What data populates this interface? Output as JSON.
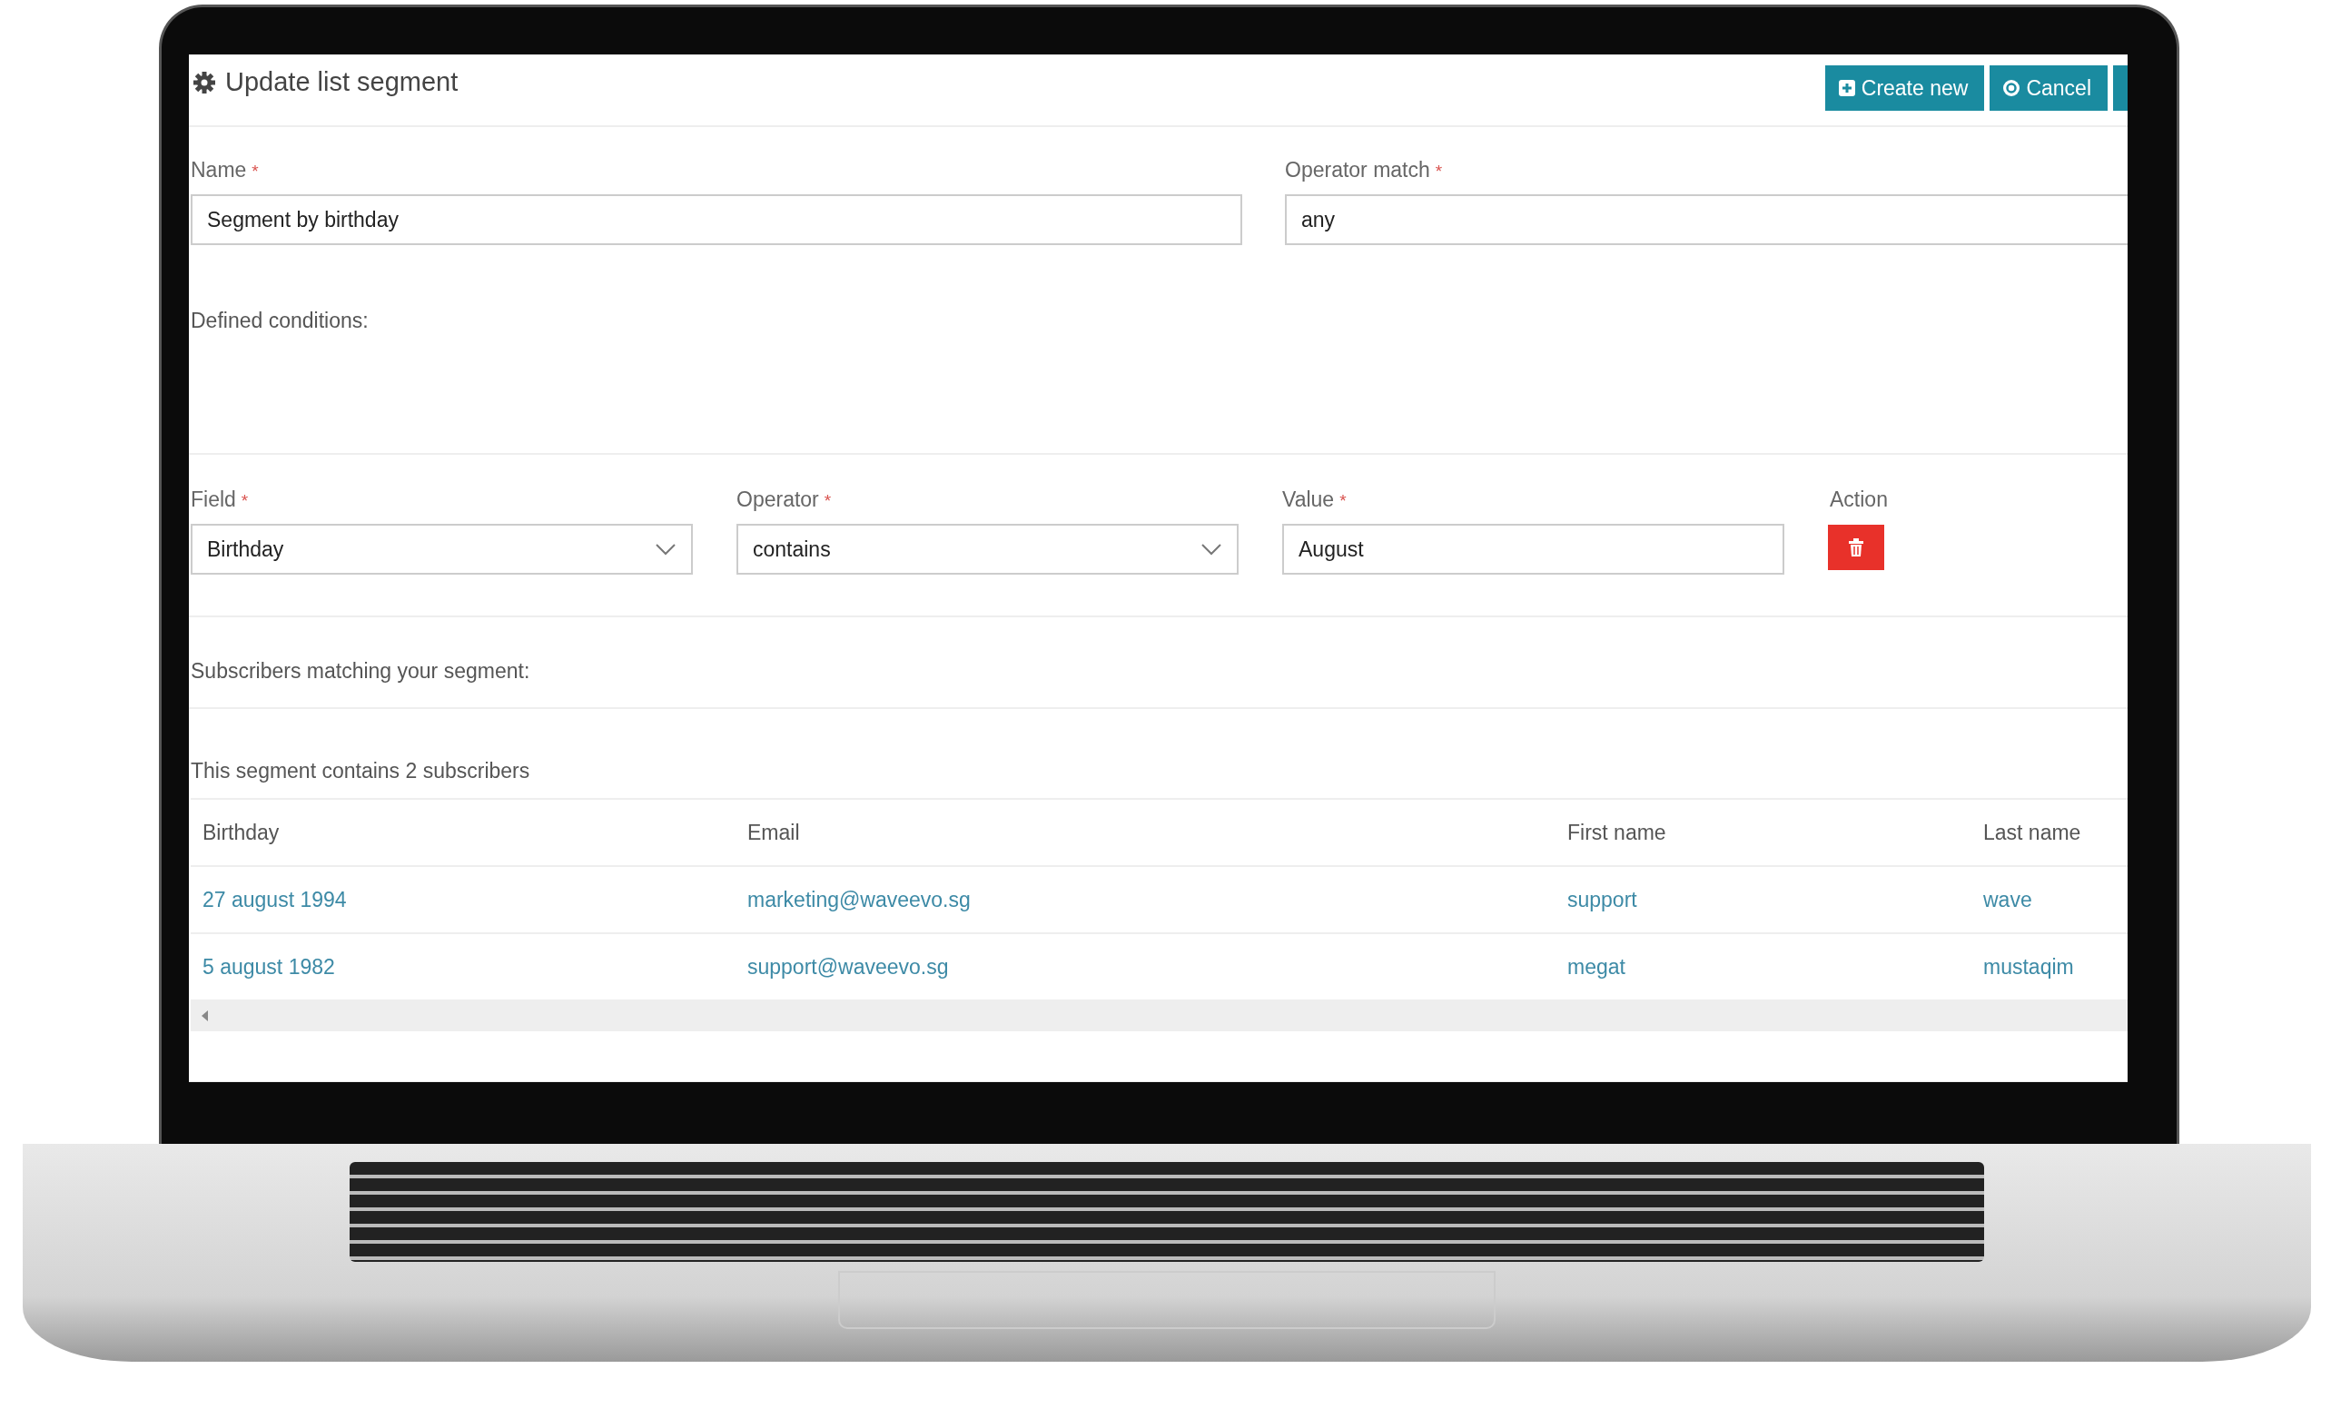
{
  "header": {
    "title": "Update list segment",
    "buttons": [
      {
        "label": "Create new",
        "kind": "create"
      },
      {
        "label": "Cancel",
        "kind": "cancel"
      }
    ]
  },
  "form": [
    {
      "label": "Name",
      "required_mark": "*",
      "value": "Segment by birthday"
    },
    {
      "label": "Operator match",
      "required_mark": "*",
      "value": "any"
    }
  ],
  "defined_conditions_label": "Defined conditions:",
  "condition": {
    "fields": [
      {
        "label": "Field",
        "required_mark": "*",
        "value": "Birthday",
        "kind": "select"
      },
      {
        "label": "Operator",
        "required_mark": "*",
        "value": "contains",
        "kind": "select"
      },
      {
        "label": "Value",
        "required_mark": "*",
        "value": "August",
        "kind": "text"
      }
    ],
    "action_label": "Action"
  },
  "matching_label": "Subscribers matching your segment:",
  "count_text": "This segment contains 2 subscribers",
  "table": {
    "columns": [
      "Birthday",
      "Email",
      "First name",
      "Last name"
    ],
    "rows": [
      [
        "27 august 1994",
        "marketing@waveevo.sg",
        "support",
        "wave"
      ],
      [
        "5 august 1982",
        "support@waveevo.sg",
        "megat",
        "mustaqim"
      ]
    ]
  }
}
